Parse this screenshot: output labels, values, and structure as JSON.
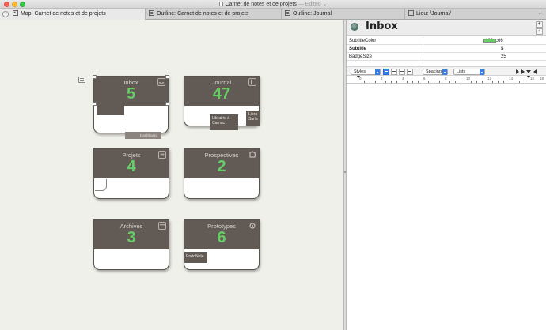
{
  "window": {
    "title": "Carnet de notes et de projets",
    "edited": "— Edited ⌄"
  },
  "tabs": [
    {
      "label": "Map: Carnet de notes et de projets",
      "active": true
    },
    {
      "label": "Outline: Carnet de notes et de projets",
      "active": false
    },
    {
      "label": "Outline: Journal",
      "active": false
    },
    {
      "label": "Lieu: /Journal/",
      "active": false
    }
  ],
  "tab_add": "+",
  "map": {
    "cards": [
      {
        "title": "Inbox",
        "count": "5",
        "icon": "inbox-icon"
      },
      {
        "title": "Journal",
        "count": "47",
        "icon": "book-icon"
      },
      {
        "title": "Projets",
        "count": "4",
        "icon": "list-icon"
      },
      {
        "title": "Prospectives",
        "count": "2",
        "icon": "puzzle-icon"
      },
      {
        "title": "Archives",
        "count": "3",
        "icon": "archive-icon"
      },
      {
        "title": "Prototypes",
        "count": "6",
        "icon": "gear-icon"
      }
    ],
    "notes": {
      "journal_note_1": "Librairie à Carnac",
      "journal_note_2": "Libra Sarla",
      "dashboard_label": "Dashboard",
      "prototype_note": "ProtoNote"
    },
    "count_color": "#66cc66"
  },
  "inspector": {
    "title": "Inbox",
    "add_button": "+",
    "remove_button": "-",
    "attributes": [
      {
        "name": "SubtitleColor",
        "value": "#66cc66",
        "bold": false
      },
      {
        "name": "Subtitle",
        "value": "$",
        "bold": true
      },
      {
        "name": "BadgeSize",
        "value": "25",
        "bold": false
      }
    ],
    "format_bar": {
      "styles": "Styles",
      "spacing": "Spacing",
      "lists": "Lists"
    },
    "ruler_numbers": [
      "0",
      "2",
      "4",
      "6",
      "8",
      "10",
      "12",
      "14",
      "16",
      "18"
    ]
  }
}
